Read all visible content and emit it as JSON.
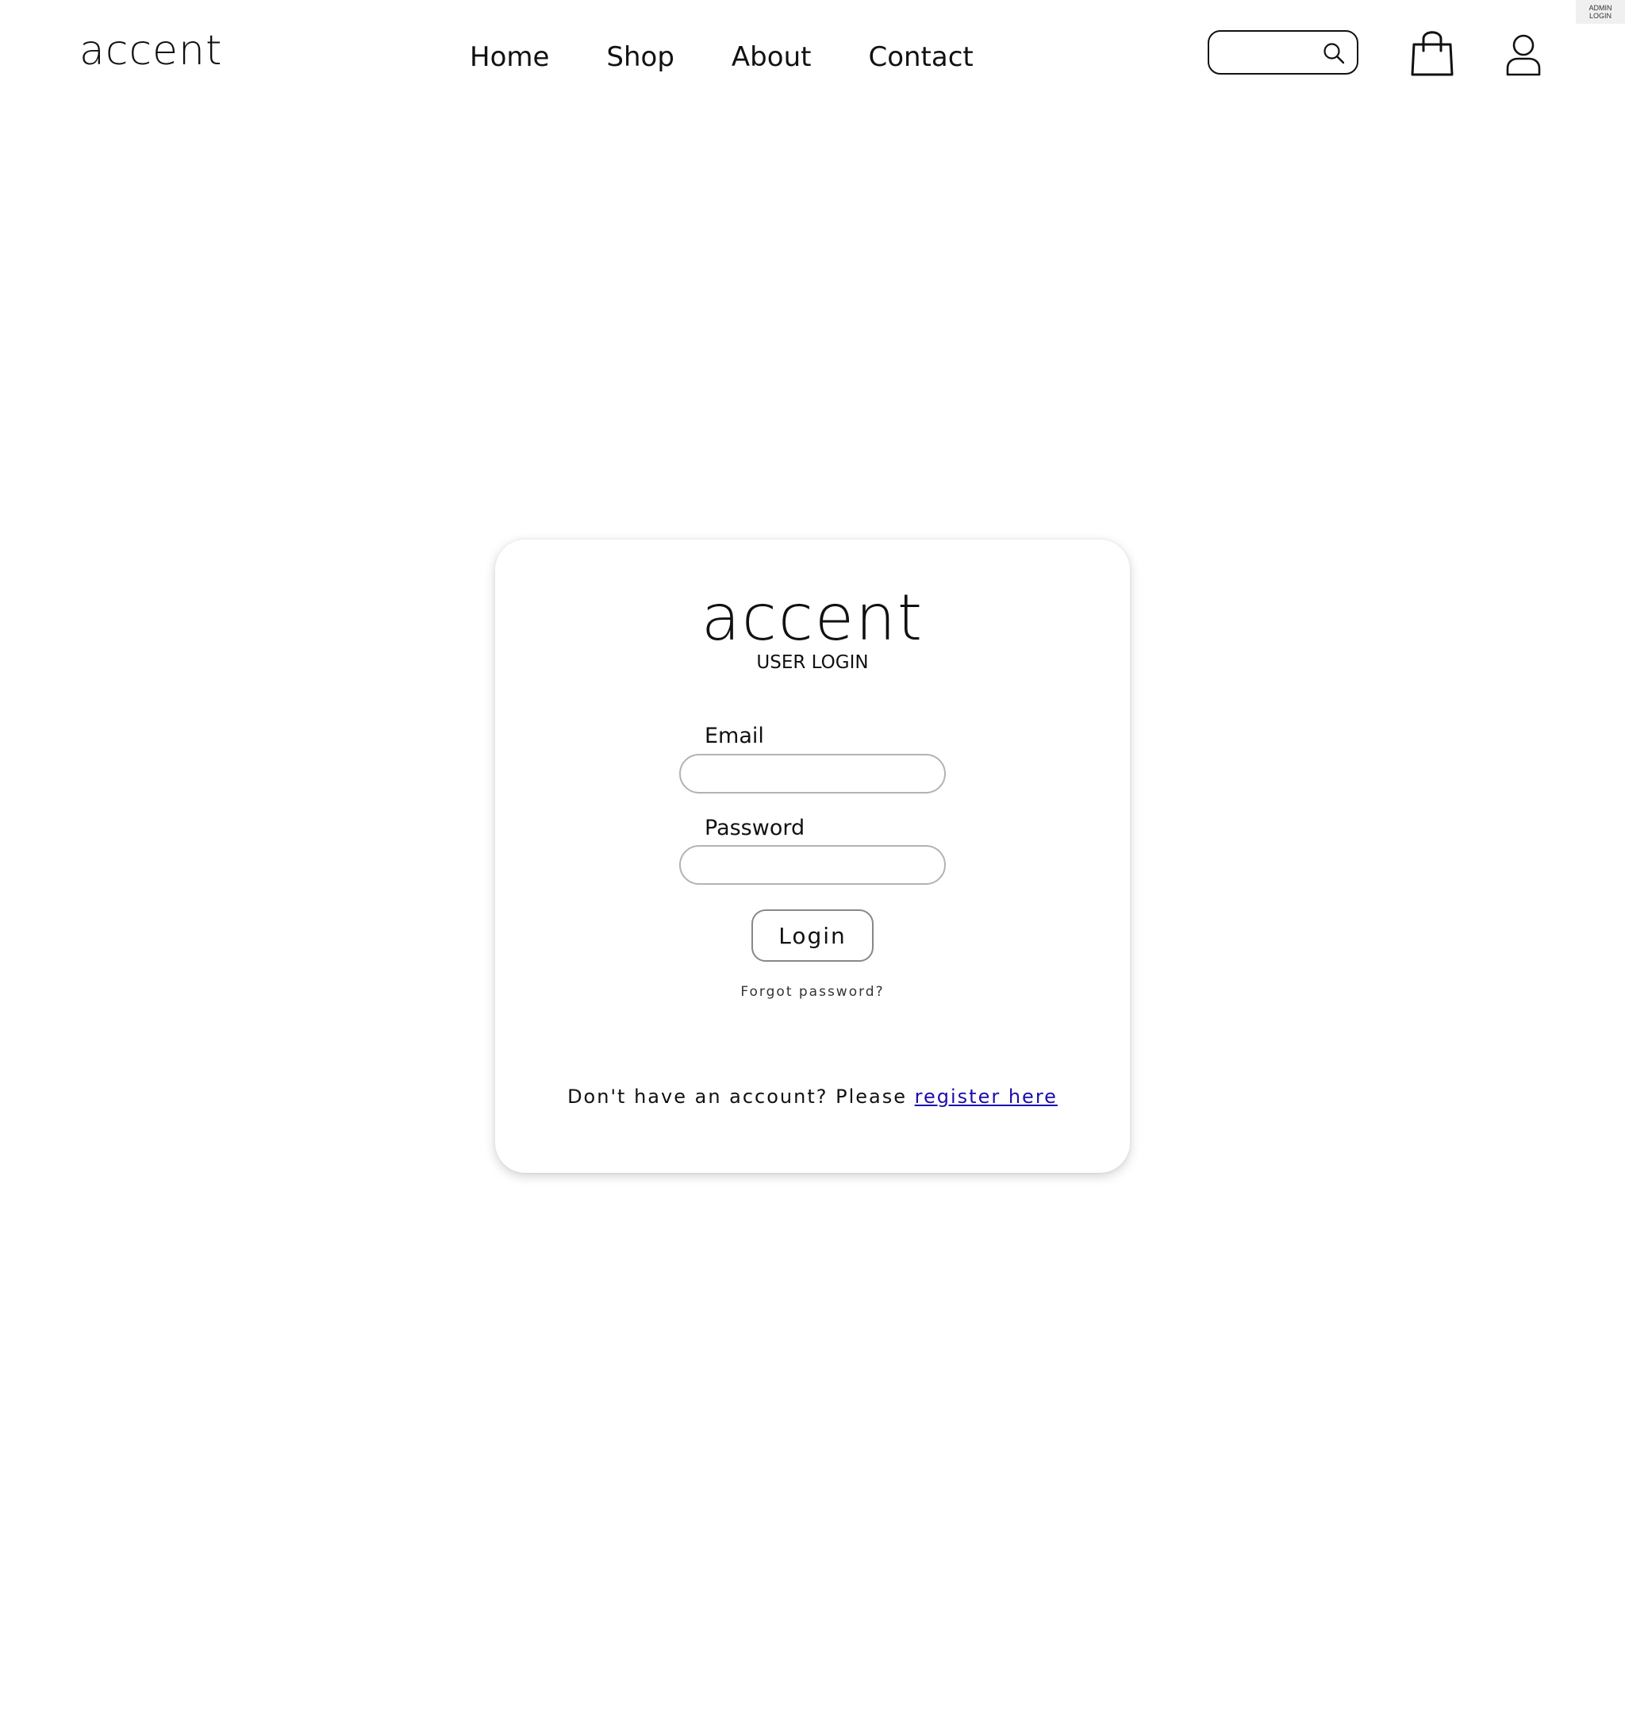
{
  "admin": {
    "line1": "ADMIN",
    "line2": "LOGIN"
  },
  "header": {
    "brand": "accent",
    "nav": [
      {
        "label": "Home"
      },
      {
        "label": "Shop"
      },
      {
        "label": "About"
      },
      {
        "label": "Contact"
      }
    ],
    "search": {
      "value": "",
      "placeholder": "",
      "icon": "search-icon"
    },
    "cart_icon": "shopping-bag-icon",
    "user_icon": "user-icon"
  },
  "card": {
    "brand": "accent",
    "heading": "USER LOGIN",
    "email_label": "Email",
    "email_value": "",
    "password_label": "Password",
    "password_value": "",
    "login_label": "Login",
    "forgot_label": "Forgot password?",
    "register_prefix": "Don't have an account? Please ",
    "register_link": "register here",
    "link_color": "#1a0dab"
  }
}
